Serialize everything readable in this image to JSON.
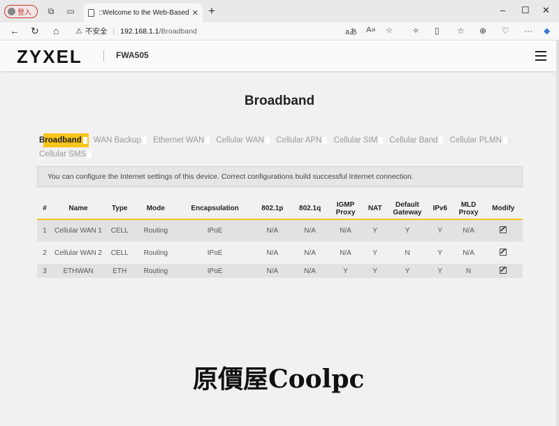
{
  "browser": {
    "profile_label": "登入",
    "tab_title": "::Welcome to the Web-Based Co",
    "tab_close": "✕",
    "new_tab": "+",
    "address": {
      "warning": "不安全",
      "host": "192.168.1.1",
      "path": "/Broadband"
    },
    "window_controls": [
      "–",
      "☐",
      "✕"
    ]
  },
  "header": {
    "logo": "ZYXEL",
    "model": "FWA505"
  },
  "page_title": "Broadband",
  "tabs": [
    {
      "label": "Broadband",
      "active": true
    },
    {
      "label": "WAN Backup",
      "active": false
    },
    {
      "label": "Ethernet WAN",
      "active": false
    },
    {
      "label": "Cellular WAN",
      "active": false
    },
    {
      "label": "Cellular APN",
      "active": false
    },
    {
      "label": "Cellular SIM",
      "active": false
    },
    {
      "label": "Cellular Band",
      "active": false
    },
    {
      "label": "Cellular PLMN",
      "active": false
    },
    {
      "label": "Cellular SMS",
      "active": false
    }
  ],
  "notice": "You can configure the Internet settings of this device. Correct configurations build successful Internet connection.",
  "table": {
    "columns": [
      "#",
      "Name",
      "Type",
      "Mode",
      "Encapsulation",
      "802.1p",
      "802.1q",
      "IGMP Proxy",
      "NAT",
      "Default Gateway",
      "IPv6",
      "MLD Proxy",
      "Modify"
    ],
    "rows": [
      [
        "1",
        "Cellular WAN 1",
        "CELL",
        "Routing",
        "IPoE",
        "N/A",
        "N/A",
        "N/A",
        "Y",
        "Y",
        "Y",
        "N/A"
      ],
      [
        "2",
        "Cellular WAN 2",
        "CELL",
        "Routing",
        "IPoE",
        "N/A",
        "N/A",
        "N/A",
        "Y",
        "N",
        "Y",
        "N/A"
      ],
      [
        "3",
        "ETHWAN",
        "ETH",
        "Routing",
        "IPoE",
        "N/A",
        "N/A",
        "Y",
        "Y",
        "Y",
        "Y",
        "N"
      ]
    ]
  },
  "watermark": "原價屋Coolpc",
  "colors": {
    "accent": "#f5c518",
    "profile_red": "#c0392b"
  }
}
